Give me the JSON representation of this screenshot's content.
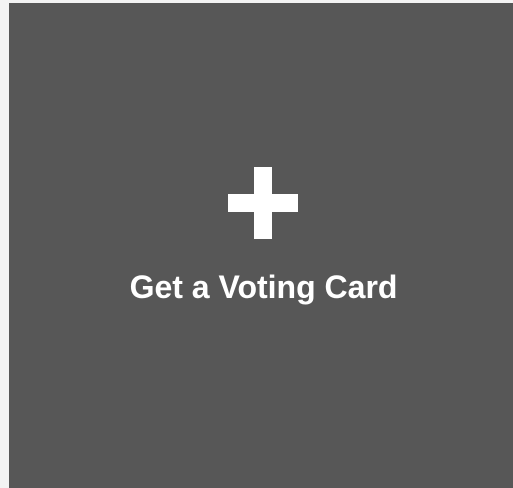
{
  "card": {
    "label": "Get a Voting Card",
    "icon": "plus-icon",
    "background_color": "#575757",
    "text_color": "#ffffff"
  }
}
